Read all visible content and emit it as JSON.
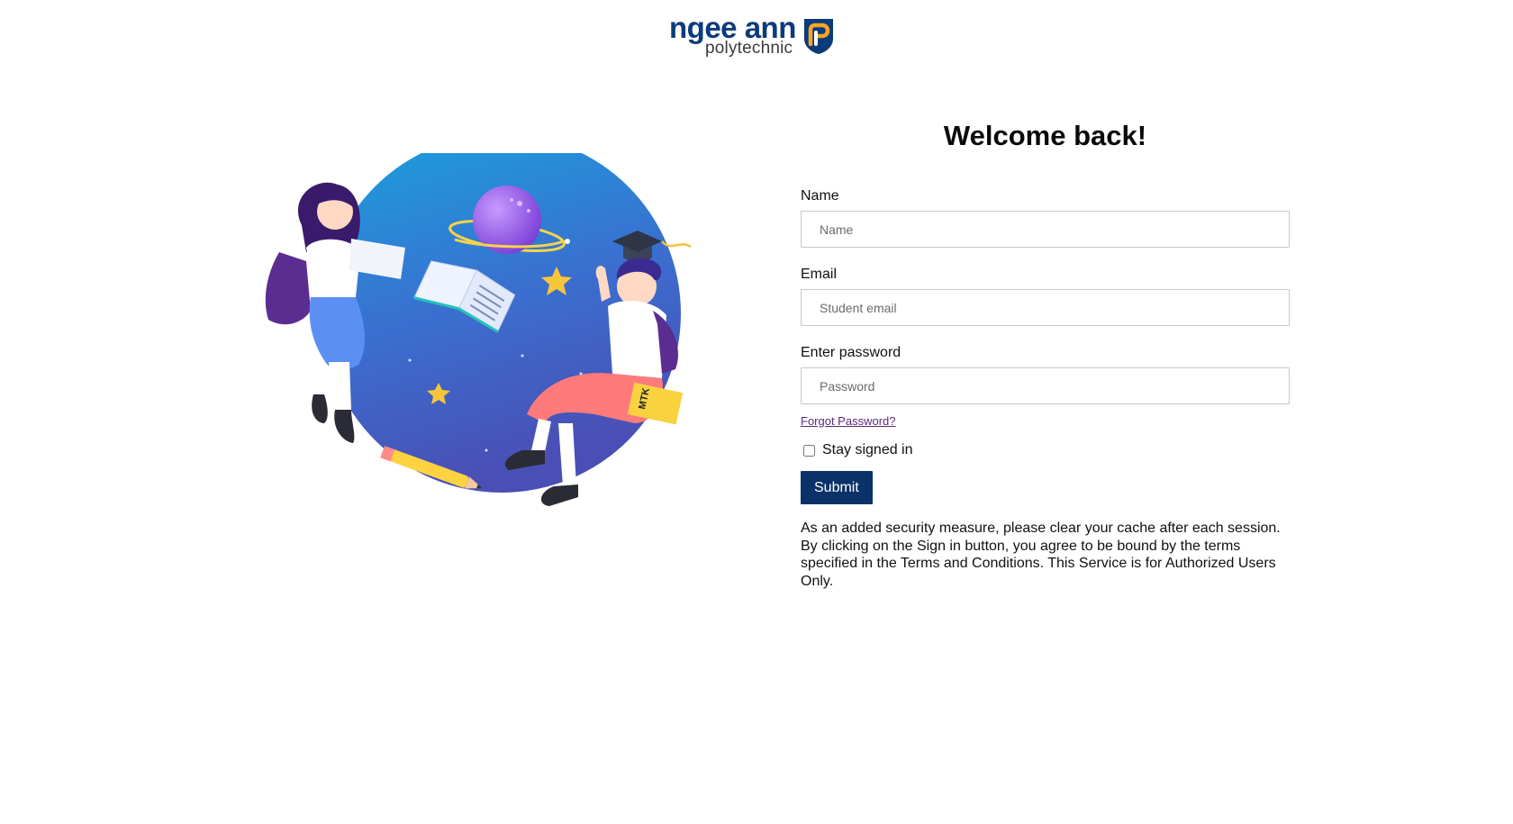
{
  "logo": {
    "main_text": "ngee ann",
    "sub_text": "polytechnic"
  },
  "illustration": {
    "book_label": "MTK"
  },
  "form": {
    "title": "Welcome back!",
    "name_label": "Name",
    "name_placeholder": "Name",
    "email_label": "Email",
    "email_placeholder": "Student email",
    "password_label": "Enter password",
    "password_placeholder": "Password",
    "forgot_link": "Forgot Password?",
    "stay_signed_in_label": "Stay signed in",
    "stay_signed_in_checked": false,
    "submit_label": "Submit",
    "notice": "As an added security measure, please clear your cache after each session. By clicking on the Sign in button, you agree to be bound by the terms specified in the Terms and Conditions. This Service is for Authorized Users Only."
  },
  "colors": {
    "brand_navy": "#0b3268",
    "logo_blue": "#0b3b7a",
    "logo_gold": "#f5a623",
    "link_purple": "#5b2a7a"
  }
}
